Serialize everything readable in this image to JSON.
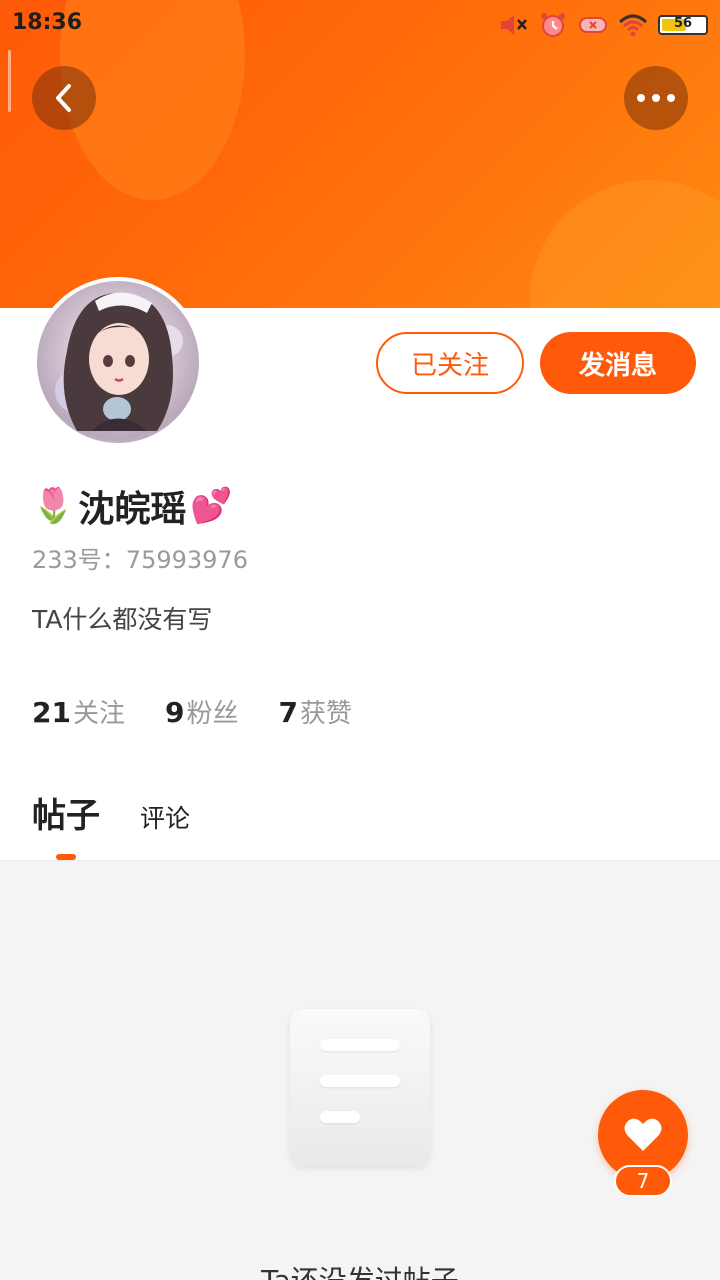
{
  "status_bar": {
    "time": "18:36",
    "battery_level": "56",
    "icons": [
      "volume-muted-icon",
      "alarm-icon",
      "data-off-icon",
      "wifi-icon",
      "battery-icon"
    ]
  },
  "header": {
    "back_icon": "chevron-left-icon",
    "more_icon": "more-dots-icon",
    "banner_color": "#ff6a0a"
  },
  "profile": {
    "name_prefix_emoji": "🌷",
    "name": "沈皖瑶",
    "name_suffix_emoji": "💕",
    "user_id": "233号：75993976",
    "bio": "TA什么都没有写",
    "follow_button": "已关注",
    "message_button": "发消息"
  },
  "stats": [
    {
      "value": "21",
      "label": "关注"
    },
    {
      "value": "9",
      "label": "粉丝"
    },
    {
      "value": "7",
      "label": "获赞"
    }
  ],
  "tabs": [
    {
      "label": "帖子",
      "active": true
    },
    {
      "label": "评论",
      "active": false
    }
  ],
  "content": {
    "empty_text": "Ta还没发过帖子"
  },
  "like_fab": {
    "icon": "heart-icon",
    "count": "7"
  },
  "accent_color": "#ff5a0a"
}
